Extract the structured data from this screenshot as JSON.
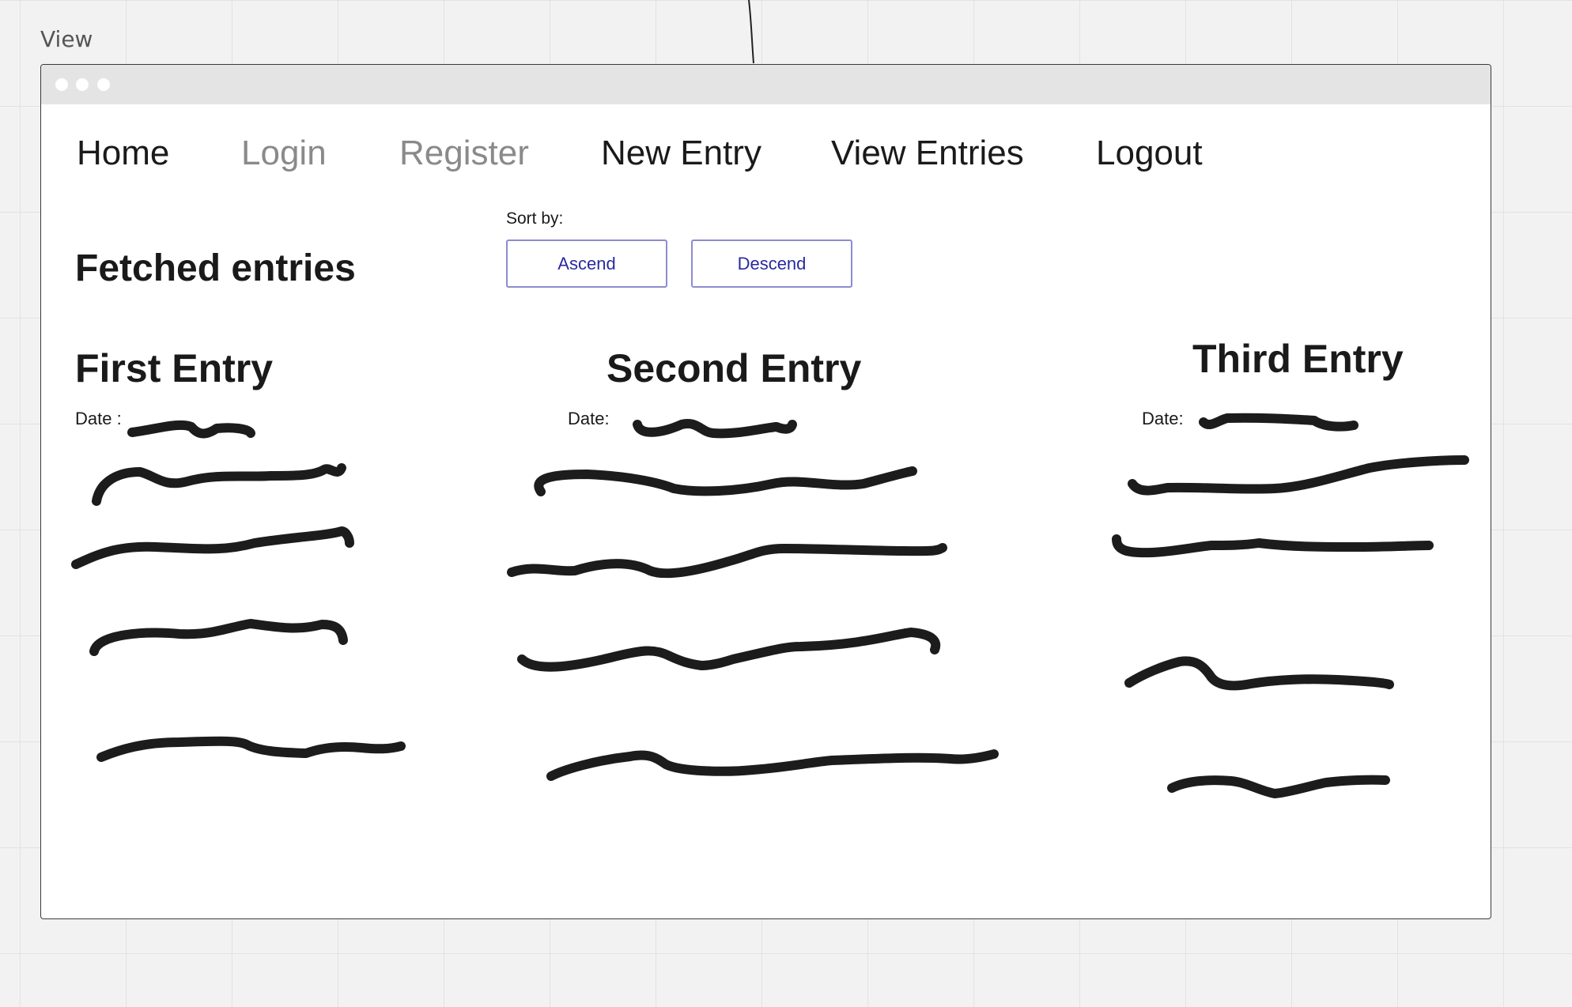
{
  "frame": {
    "label": "View"
  },
  "nav": {
    "items": [
      {
        "label": "Home",
        "state": "active"
      },
      {
        "label": "Login",
        "state": "muted"
      },
      {
        "label": "Register",
        "state": "muted"
      },
      {
        "label": "New Entry",
        "state": "active"
      },
      {
        "label": "View Entries",
        "state": "active"
      },
      {
        "label": "Logout",
        "state": "active"
      }
    ]
  },
  "main": {
    "title": "Fetched entries",
    "sort": {
      "label": "Sort by:",
      "ascend_label": "Ascend",
      "descend_label": "Descend"
    },
    "entries": [
      {
        "title": "First Entry",
        "date_label": "Date :"
      },
      {
        "title": "Second Entry",
        "date_label": "Date:"
      },
      {
        "title": "Third Entry",
        "date_label": "Date:"
      }
    ]
  },
  "colors": {
    "background": "#f2f2f2",
    "window": "#ffffff",
    "titlebar": "#e4e4e4",
    "text": "#1a1a1a",
    "muted_text": "#8a8a8a",
    "button_border": "#8c8cd0",
    "button_text": "#2a2aa0",
    "scribble": "#1c1c1c"
  }
}
